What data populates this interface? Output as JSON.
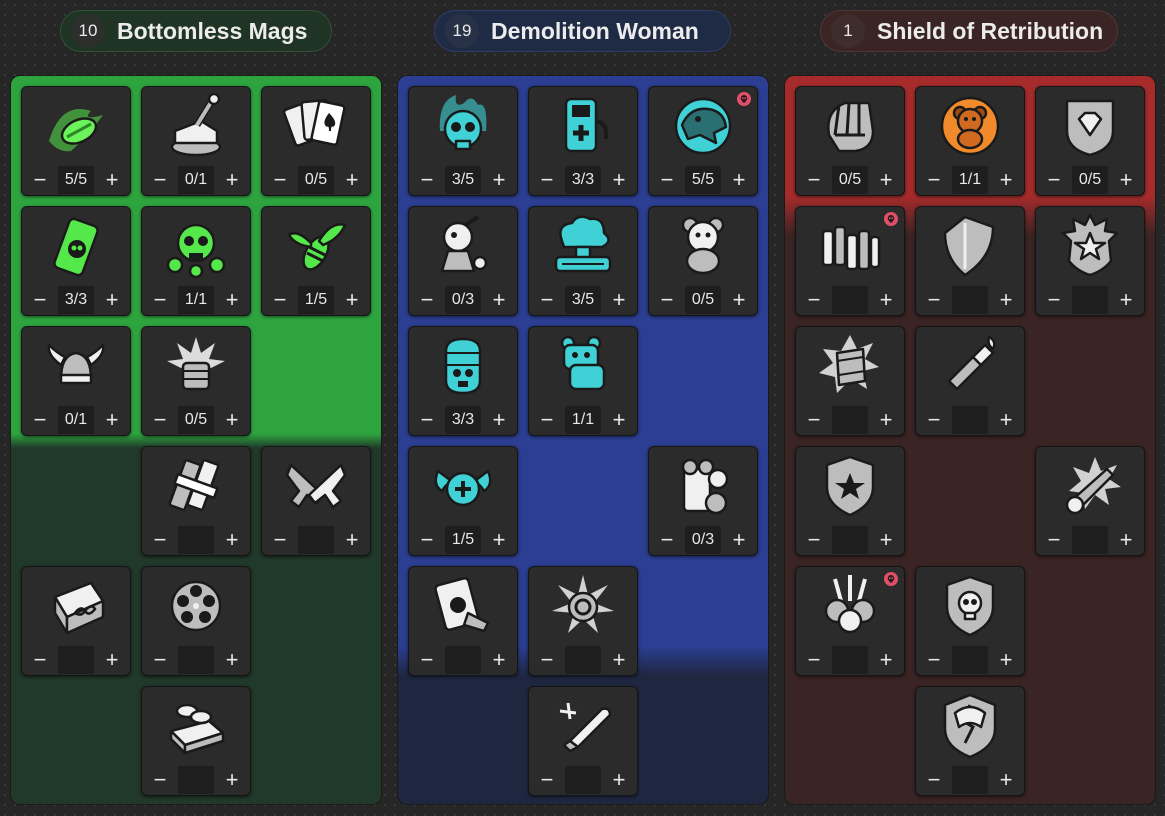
{
  "trees": [
    {
      "name": "Bottomless Mags",
      "points": "10",
      "color": "#55e84a",
      "skills": [
        {
          "id": "g1",
          "icon": "green-bullet-icon",
          "rank": "5/5"
        },
        {
          "id": "g2",
          "icon": "lever-icon",
          "rank": "0/1"
        },
        {
          "id": "g3",
          "icon": "playing-cards-icon",
          "rank": "0/5"
        },
        {
          "id": "g4",
          "icon": "skull-lighter-icon",
          "rank": "3/3"
        },
        {
          "id": "g5",
          "icon": "skull-grenades-icon",
          "rank": "1/1"
        },
        {
          "id": "g6",
          "icon": "wasp-icon",
          "rank": "1/5"
        },
        {
          "id": "g7",
          "icon": "winged-helmet-icon",
          "rank": "0/1"
        },
        {
          "id": "g8",
          "icon": "barrel-burst-icon",
          "rank": "0/5"
        },
        {
          "id": "g9",
          "icon": "taped-magazine-icon",
          "rank": ""
        },
        {
          "id": "g10",
          "icon": "crossed-pistols-icon",
          "rank": ""
        },
        {
          "id": "g11",
          "icon": "infinite-ammo-box-icon",
          "rank": ""
        },
        {
          "id": "g12",
          "icon": "revolver-cylinder-icon",
          "rank": ""
        },
        {
          "id": "g13",
          "icon": "ammo-crate-icon",
          "rank": ""
        }
      ]
    },
    {
      "name": "Demolition Woman",
      "points": "19",
      "color": "#3fd1d6",
      "skills": [
        {
          "id": "b1",
          "icon": "flaming-skull-icon",
          "rank": "3/5"
        },
        {
          "id": "b2",
          "icon": "health-dispenser-icon",
          "rank": "3/3"
        },
        {
          "id": "b3",
          "icon": "roaring-bear-icon",
          "rank": "5/5",
          "badge": true
        },
        {
          "id": "b4",
          "icon": "bomb-person-icon",
          "rank": "0/3"
        },
        {
          "id": "b5",
          "icon": "torgue-explosion-icon",
          "rank": "3/5"
        },
        {
          "id": "b6",
          "icon": "teddy-bear-icon",
          "rank": "0/5"
        },
        {
          "id": "b7",
          "icon": "grenade-skull-icon",
          "rank": "3/3"
        },
        {
          "id": "b8",
          "icon": "robot-bear-icon",
          "rank": "1/1"
        },
        {
          "id": "b9",
          "icon": "drone-medic-icon",
          "rank": "1/5"
        },
        {
          "id": "b10",
          "icon": "exploding-bear-icon",
          "rank": "0/3"
        },
        {
          "id": "b11",
          "icon": "grenade-card-icon",
          "rank": ""
        },
        {
          "id": "b12",
          "icon": "grenade-pin-icon",
          "rank": ""
        },
        {
          "id": "b13",
          "icon": "bullet-spark-icon",
          "rank": ""
        }
      ]
    },
    {
      "name": "Shield of Retribution",
      "points": "1",
      "color": "#f08a2a",
      "skills": [
        {
          "id": "r1",
          "icon": "bullet-fist-icon",
          "rank": "0/5"
        },
        {
          "id": "r2",
          "icon": "orange-teddy-icon",
          "rank": "1/1"
        },
        {
          "id": "r3",
          "icon": "diamond-shield-icon",
          "rank": "0/5"
        },
        {
          "id": "r4",
          "icon": "ammo-rows-icon",
          "rank": "",
          "badge": true
        },
        {
          "id": "r5",
          "icon": "metal-shield-icon",
          "rank": ""
        },
        {
          "id": "r6",
          "icon": "rank-shield-icon",
          "rank": ""
        },
        {
          "id": "r7",
          "icon": "crushed-can-icon",
          "rank": ""
        },
        {
          "id": "r8",
          "icon": "molotov-icon",
          "rank": ""
        },
        {
          "id": "r9",
          "icon": "police-badge-icon",
          "rank": ""
        },
        {
          "id": "r10",
          "icon": "shotgun-blast-icon",
          "rank": ""
        },
        {
          "id": "r11",
          "icon": "feathered-orbs-icon",
          "rank": "",
          "badge": true
        },
        {
          "id": "r12",
          "icon": "skull-shield-icon",
          "rank": ""
        },
        {
          "id": "r13",
          "icon": "broken-shield-icon",
          "rank": ""
        }
      ]
    }
  ],
  "controls": {
    "minus": "−",
    "plus": "+"
  }
}
